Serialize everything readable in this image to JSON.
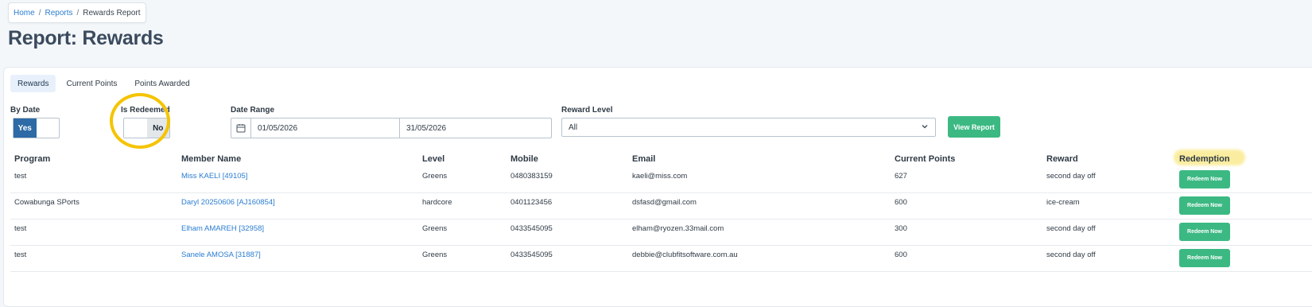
{
  "breadcrumb": {
    "home": "Home",
    "reports": "Reports",
    "current": "Rewards Report",
    "separator": "/"
  },
  "page_title": "Report: Rewards",
  "tabs": [
    {
      "label": "Rewards",
      "active": true
    },
    {
      "label": "Current Points",
      "active": false
    },
    {
      "label": "Points Awarded",
      "active": false
    }
  ],
  "filters": {
    "by_date": {
      "label": "By Date",
      "on": "Yes",
      "selected": "Yes"
    },
    "is_redeemed": {
      "label": "Is Redeemed",
      "off": "No",
      "selected": "No"
    },
    "date_range": {
      "label": "Date Range",
      "from": "01/05/2026",
      "to": "31/05/2026"
    },
    "reward_level": {
      "label": "Reward Level",
      "value": "All"
    },
    "view_button": "View Report"
  },
  "table": {
    "headers": {
      "program": "Program",
      "member": "Member Name",
      "level": "Level",
      "mobile": "Mobile",
      "email": "Email",
      "points": "Current Points",
      "reward": "Reward",
      "redemption": "Redemption"
    },
    "rows": [
      {
        "program": "test",
        "member": "Miss KAELI [49105]",
        "level": "Greens",
        "mobile": "0480383159",
        "email": "kaeli@miss.com",
        "points": "627",
        "reward": "second day off",
        "action": "Redeem Now"
      },
      {
        "program": "Cowabunga SPorts",
        "member": "Daryl 20250606 [AJ160854]",
        "level": "hardcore",
        "mobile": "0401123456",
        "email": "dsfasd@gmail.com",
        "points": "600",
        "reward": "ice-cream",
        "action": "Redeem Now"
      },
      {
        "program": "test",
        "member": "Elham AMAREH [32958]",
        "level": "Greens",
        "mobile": "0433545095",
        "email": "elham@ryozen.33mail.com",
        "points": "300",
        "reward": "second day off",
        "action": "Redeem Now"
      },
      {
        "program": "test",
        "member": "Sanele AMOSA [31887]",
        "level": "Greens",
        "mobile": "0433545095",
        "email": "debbie@clubfitsoftware.com.au",
        "points": "600",
        "reward": "second day off",
        "action": "Redeem Now"
      }
    ]
  },
  "colors": {
    "accent": "#2d6aa6",
    "green": "#3cb983",
    "link": "#2b7dd1",
    "annotation": "#f5c400"
  }
}
